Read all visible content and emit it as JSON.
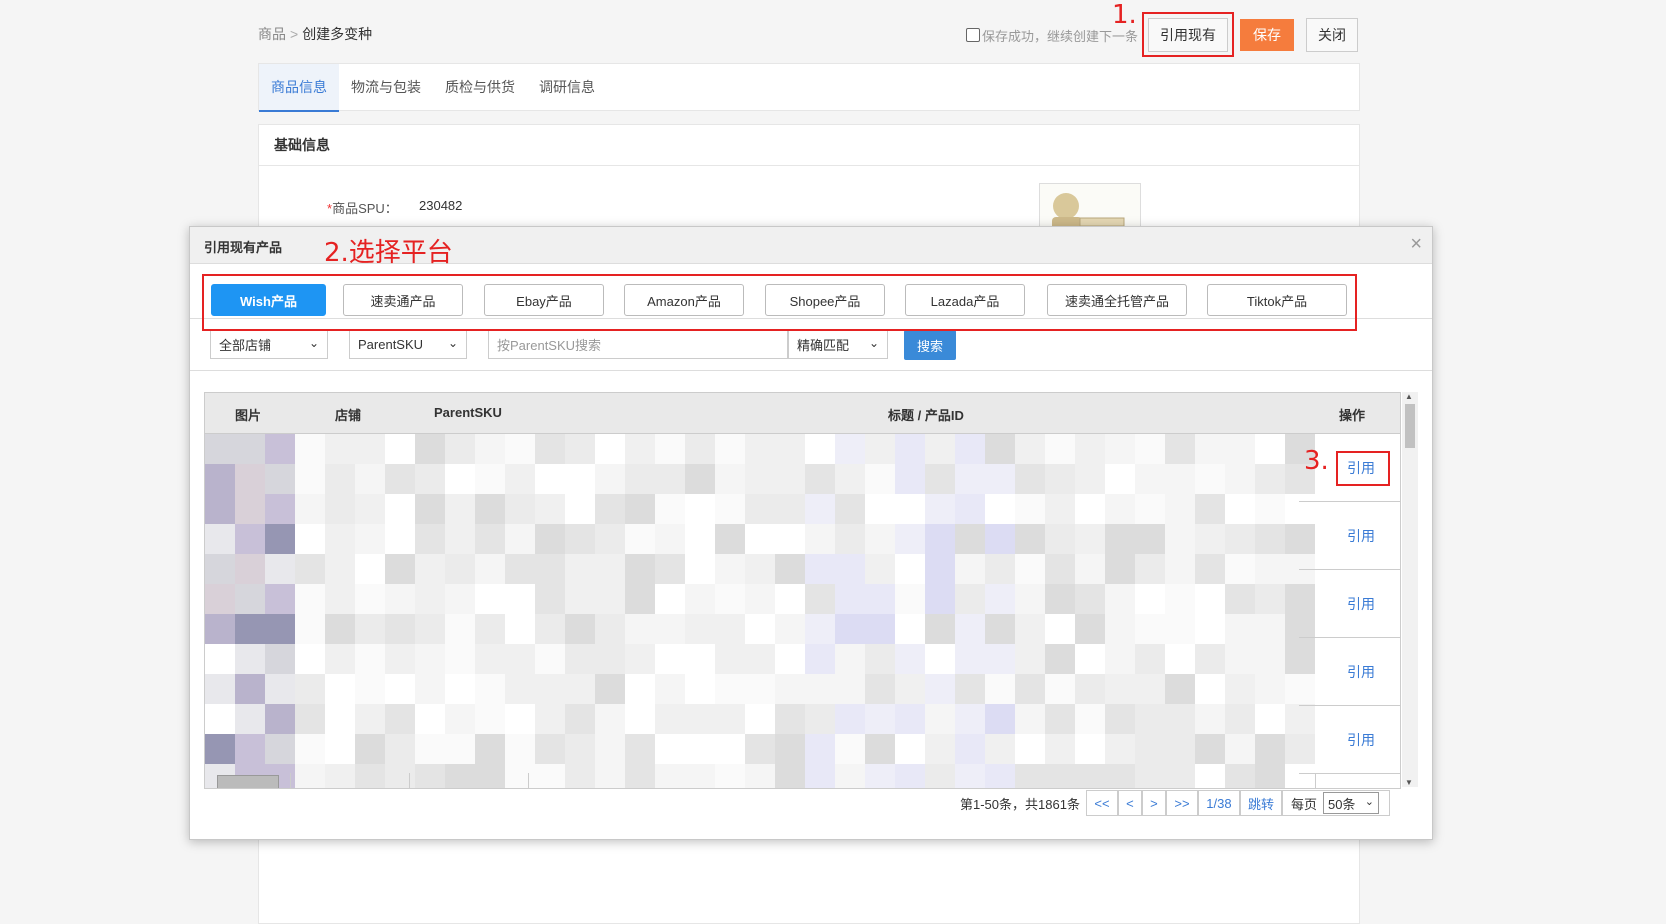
{
  "breadcrumb": {
    "root": "商品",
    "sep": ">",
    "current": "创建多变种"
  },
  "top_actions": {
    "continue_label": "保存成功，继续创建下一条",
    "reference_label": "引用现有",
    "save_label": "保存",
    "close_label": "关闭"
  },
  "tabs": [
    "商品信息",
    "物流与包装",
    "质检与供货",
    "调研信息"
  ],
  "basic_panel": {
    "title": "基础信息",
    "spu_label": "商品SPU：",
    "spu_value": "230482"
  },
  "modal": {
    "title": "引用现有产品",
    "close_glyph": "×",
    "platforms": [
      "Wish产品",
      "速卖通产品",
      "Ebay产品",
      "Amazon产品",
      "Shopee产品",
      "Lazada产品",
      "速卖通全托管产品",
      "Tiktok产品"
    ],
    "active_platform": "Wish产品",
    "filters": {
      "store": "全部店铺",
      "field": "ParentSKU",
      "search_placeholder": "按ParentSKU搜索",
      "match": "精确匹配",
      "search_button": "搜索"
    },
    "table": {
      "headers": [
        "图片",
        "店铺",
        "ParentSKU",
        "标题 / 产品ID",
        "操作"
      ],
      "action_label": "引用",
      "row_count_visible": 5
    },
    "pagination": {
      "summary": "第1-50条，共1861条",
      "first": "<<",
      "prev": "<",
      "next": ">",
      "last": ">>",
      "page": "1/38",
      "jump": "跳转",
      "per_page_label": "每页",
      "per_page_value": "50条"
    }
  },
  "annotations": {
    "step1": "1.",
    "step2": "2.选择平台",
    "step3": "3."
  },
  "colors": {
    "accent": "#1e95f3",
    "save": "#f57c3d",
    "link": "#3a7bd5",
    "annotation": "#e52222"
  }
}
